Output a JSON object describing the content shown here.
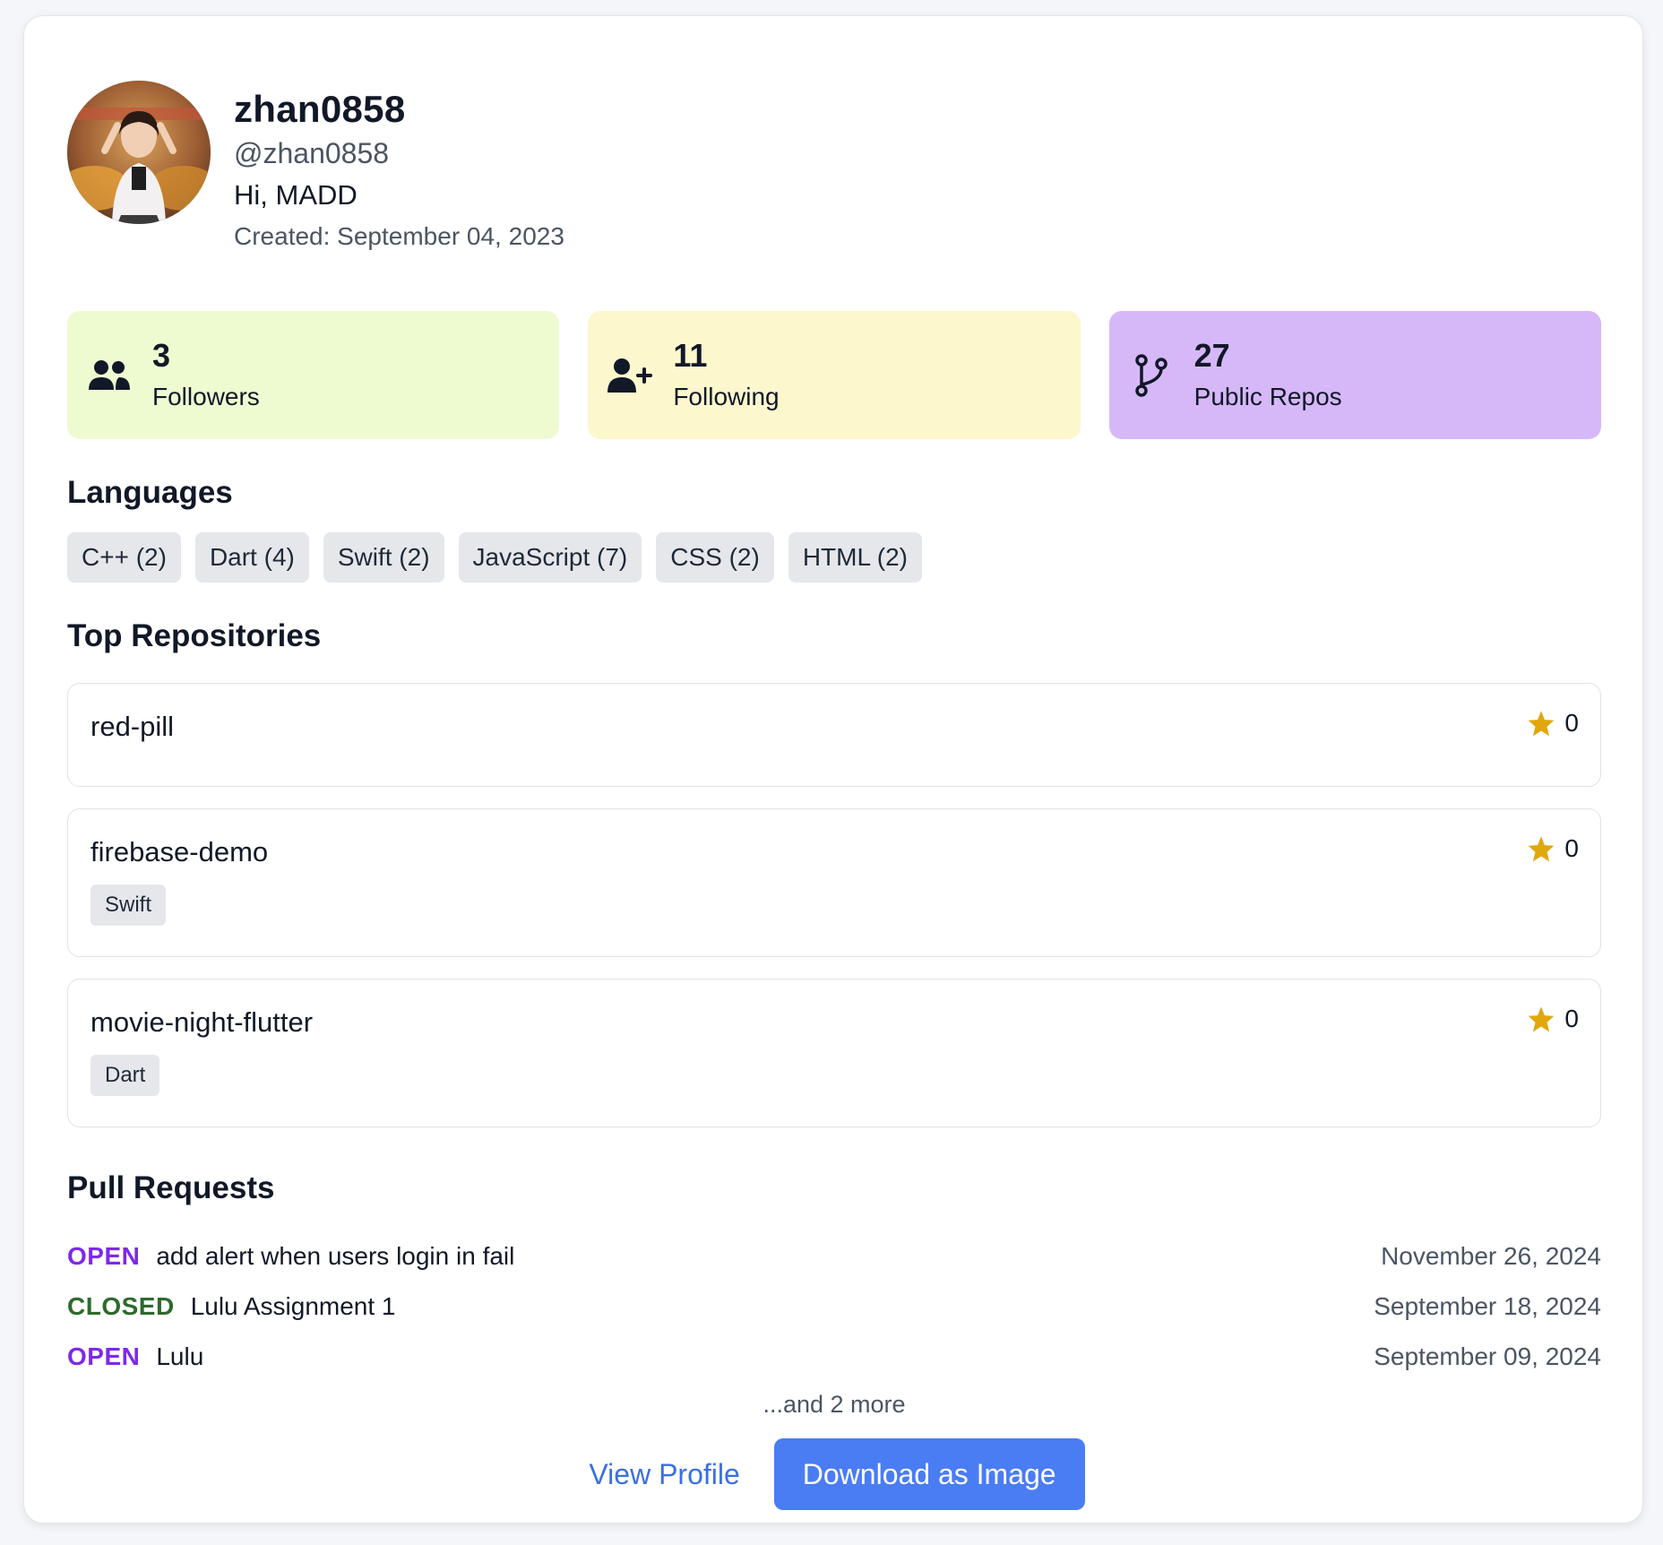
{
  "profile": {
    "name": "zhan0858",
    "handle": "@zhan0858",
    "bio": "Hi, MADD",
    "created": "Created: September 04, 2023"
  },
  "stats": [
    {
      "value": "3",
      "label": "Followers",
      "icon": "users-icon",
      "color": "#eefbd0"
    },
    {
      "value": "11",
      "label": "Following",
      "icon": "user-plus-icon",
      "color": "#fdf7cd"
    },
    {
      "value": "27",
      "label": "Public Repos",
      "icon": "git-branch-icon",
      "color": "#d6b8f8"
    }
  ],
  "languages_title": "Languages",
  "languages": [
    "C++ (2)",
    "Dart (4)",
    "Swift (2)",
    "JavaScript (7)",
    "CSS (2)",
    "HTML (2)"
  ],
  "repos_title": "Top Repositories",
  "repos": [
    {
      "name": "red-pill",
      "stars": "0",
      "language": ""
    },
    {
      "name": "firebase-demo",
      "stars": "0",
      "language": "Swift"
    },
    {
      "name": "movie-night-flutter",
      "stars": "0",
      "language": "Dart"
    }
  ],
  "prs_title": "Pull Requests",
  "pull_requests": [
    {
      "state": "OPEN",
      "title": "add alert when users login in fail",
      "date": "November 26, 2024"
    },
    {
      "state": "CLOSED",
      "title": "Lulu Assignment 1",
      "date": "September 18, 2024"
    },
    {
      "state": "OPEN",
      "title": "Lulu",
      "date": "September 09, 2024"
    }
  ],
  "more_text": "...and 2 more",
  "actions": {
    "view_profile": "View Profile",
    "download": "Download as Image"
  },
  "colors": {
    "open": "#7c2ae8",
    "closed": "#2d6a2d",
    "star": "#e0a80d",
    "primary": "#4a7cf3"
  }
}
